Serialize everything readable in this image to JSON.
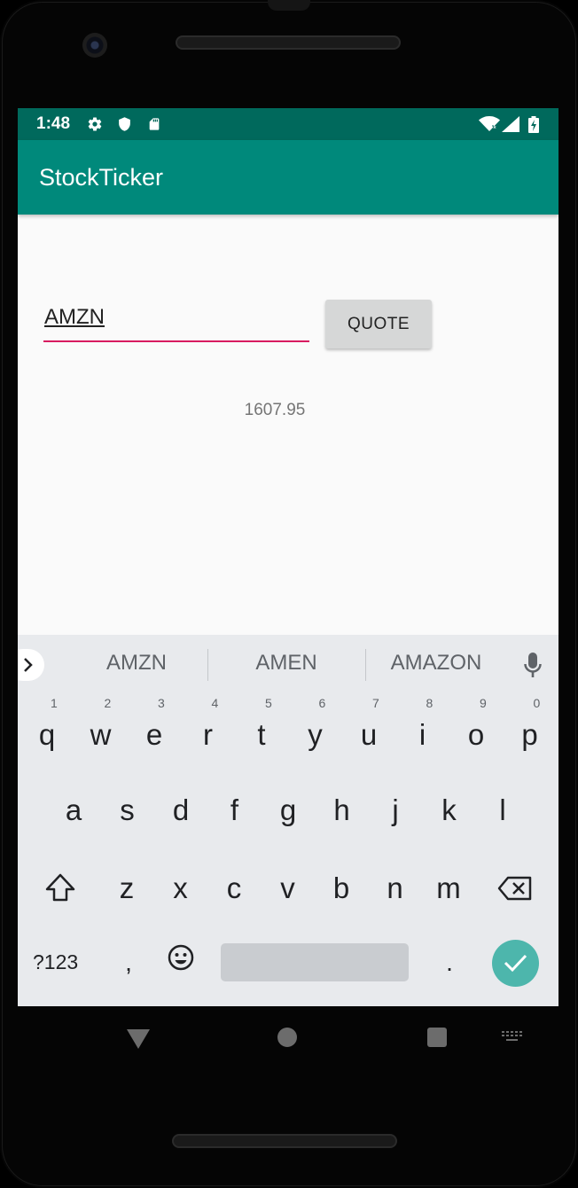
{
  "status_bar": {
    "time": "1:48",
    "icons": [
      "gear-icon",
      "shield-icon",
      "sd-card-icon",
      "wifi-icon",
      "signal-icon",
      "battery-icon"
    ]
  },
  "app_bar": {
    "title": "StockTicker"
  },
  "form": {
    "symbol_value": "AMZN",
    "quote_button_label": "QUOTE",
    "price": "1607.95"
  },
  "keyboard": {
    "suggestions": [
      "AMZN",
      "AMEN",
      "AMAZON"
    ],
    "row1": [
      "q",
      "w",
      "e",
      "r",
      "t",
      "y",
      "u",
      "i",
      "o",
      "p"
    ],
    "row1_hints": [
      "1",
      "2",
      "3",
      "4",
      "5",
      "6",
      "7",
      "8",
      "9",
      "0"
    ],
    "row2": [
      "a",
      "s",
      "d",
      "f",
      "g",
      "h",
      "j",
      "k",
      "l"
    ],
    "row3": [
      "z",
      "x",
      "c",
      "v",
      "b",
      "n",
      "m"
    ],
    "symbols_label": "?123",
    "comma": ",",
    "period": "."
  },
  "colors": {
    "status_bar": "#00695c",
    "app_bar": "#00897b",
    "accent_underline": "#d81b60",
    "enter_key": "#4db6ac"
  }
}
